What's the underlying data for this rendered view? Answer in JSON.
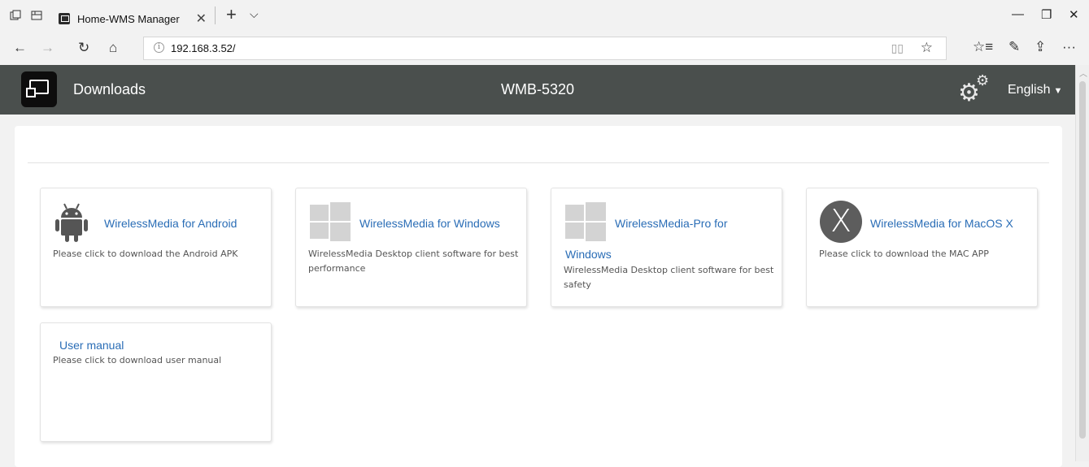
{
  "browser": {
    "tab_title": "Home-WMS Manager",
    "tab_close": "✕",
    "new_tab": "+",
    "tab_menu": "⌵",
    "url": "192.168.3.52/",
    "window_controls": {
      "minimize": "—",
      "maximize": "❐",
      "close": "✕"
    },
    "nav": {
      "back": "←",
      "forward": "→",
      "refresh": "↻",
      "home": "⌂"
    },
    "addr_icons": {
      "info": "i",
      "reading_view": "▯▯",
      "favorite": "☆"
    },
    "toolbar": {
      "favorites": "☆≡",
      "notes": "✎",
      "share": "⇪",
      "more": "···"
    }
  },
  "header": {
    "title": "Downloads",
    "model": "WMB-5320",
    "language": "English",
    "language_caret": "▼",
    "settings_icon": "gear-icon"
  },
  "cards": [
    {
      "title": "WirelessMedia for Android",
      "desc": "Please click to download the Android APK",
      "icon": "android-icon"
    },
    {
      "title": "WirelessMedia for Windows",
      "desc": "WirelessMedia Desktop client software for best performance",
      "icon": "windows-icon"
    },
    {
      "title_line1": "WirelessMedia-Pro for",
      "title_line2": "Windows",
      "desc": "WirelessMedia Desktop client software for best safety",
      "icon": "windows-icon"
    },
    {
      "title": "WirelessMedia for MacOS X",
      "desc": "Please click to download the MAC APP",
      "icon": "macos-x-icon",
      "icon_text": "X"
    },
    {
      "title": "User manual",
      "desc": "Please click to download user manual"
    }
  ],
  "colors": {
    "header_bg": "#4a4f4d",
    "link": "#2a6db6",
    "card_border": "#e3e3e3"
  }
}
